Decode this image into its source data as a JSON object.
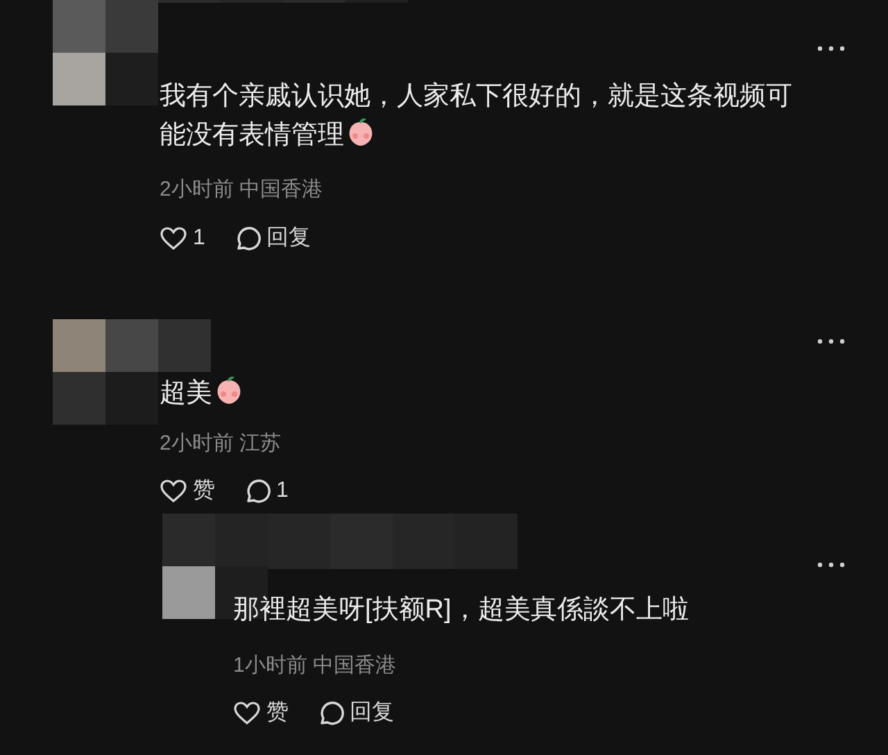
{
  "comments": [
    {
      "text": "我有个亲戚认识她，人家私下很好的，就是这条视频可能没有表情管理",
      "emoji": true,
      "meta": "2小时前 中国香港",
      "like_text": "1",
      "reply_text": "回复"
    },
    {
      "text": "超美",
      "emoji": true,
      "meta": "2小时前 江苏",
      "like_text": "赞",
      "reply_text": "1",
      "replies": [
        {
          "text": "那裡超美呀[扶额R]，超美真係談不上啦",
          "emoji": false,
          "meta": "1小时前 中国香港",
          "like_text": "赞",
          "reply_text": "回复"
        }
      ]
    }
  ]
}
